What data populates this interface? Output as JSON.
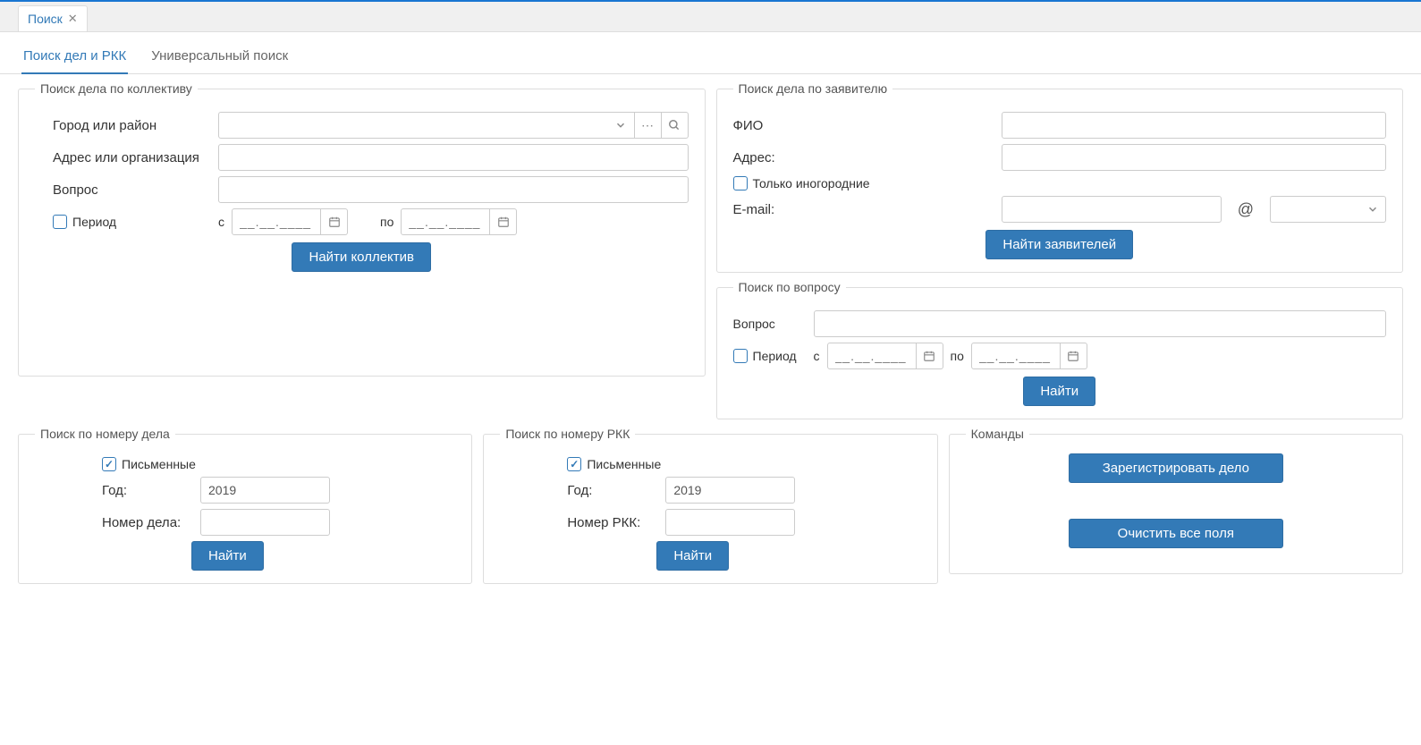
{
  "appTab": {
    "label": "Поиск"
  },
  "subTabs": {
    "active": "Поиск дел и РКК",
    "other": "Универсальный поиск"
  },
  "collectiveSearch": {
    "legend": "Поиск дела по коллективу",
    "cityLabel": "Город или район",
    "addressLabel": "Адрес или организация",
    "questionLabel": "Вопрос",
    "periodLabel": "Период",
    "fromLabel": "с",
    "toLabel": "по",
    "datePlaceholder": "__.__.____",
    "findBtn": "Найти коллектив"
  },
  "applicantSearch": {
    "legend": "Поиск дела по заявителю",
    "fioLabel": "ФИО",
    "addressLabel": "Адрес:",
    "nonresidentLabel": "Только иногородние",
    "emailLabel": "E-mail:",
    "atSign": "@",
    "findBtn": "Найти заявителей"
  },
  "questionSearch": {
    "legend": "Поиск по вопросу",
    "questionLabel": "Вопрос",
    "periodLabel": "Период",
    "fromLabel": "с",
    "toLabel": "по",
    "datePlaceholder": "__.__.____",
    "findBtn": "Найти"
  },
  "caseNumberSearch": {
    "legend": "Поиск по номеру дела",
    "writtenLabel": "Письменные",
    "yearLabel": "Год:",
    "yearValue": "2019",
    "numberLabel": "Номер дела:",
    "findBtn": "Найти"
  },
  "rkkNumberSearch": {
    "legend": "Поиск по номеру РКК",
    "writtenLabel": "Письменные",
    "yearLabel": "Год:",
    "yearValue": "2019",
    "numberLabel": "Номер РКК:",
    "findBtn": "Найти"
  },
  "commands": {
    "legend": "Команды",
    "registerBtn": "Зарегистрировать дело",
    "clearBtn": "Очистить все поля"
  }
}
